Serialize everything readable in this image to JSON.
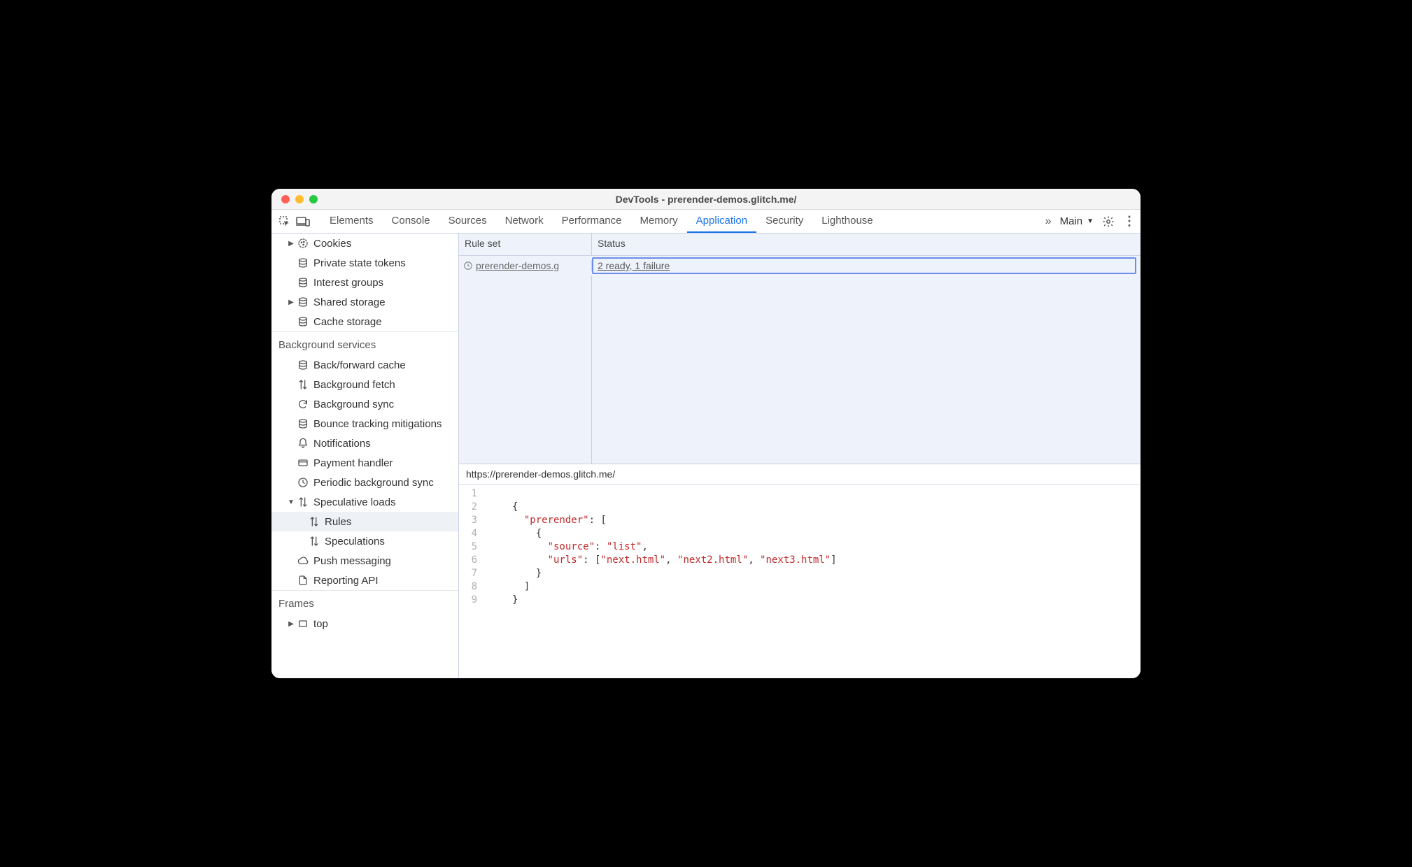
{
  "window_title": "DevTools - prerender-demos.glitch.me/",
  "toolbar": {
    "tabs": [
      "Elements",
      "Console",
      "Sources",
      "Network",
      "Performance",
      "Memory",
      "Application",
      "Security",
      "Lighthouse"
    ],
    "active_tab": "Application",
    "frame_label": "Main"
  },
  "sidebar": {
    "storage_items": [
      {
        "label": "Cookies",
        "icon": "cookie",
        "arrow": true
      },
      {
        "label": "Private state tokens",
        "icon": "db"
      },
      {
        "label": "Interest groups",
        "icon": "db"
      },
      {
        "label": "Shared storage",
        "icon": "db",
        "arrow": true
      },
      {
        "label": "Cache storage",
        "icon": "db"
      }
    ],
    "bg_header": "Background services",
    "bg_items": [
      {
        "label": "Back/forward cache",
        "icon": "db"
      },
      {
        "label": "Background fetch",
        "icon": "updown"
      },
      {
        "label": "Background sync",
        "icon": "sync"
      },
      {
        "label": "Bounce tracking mitigations",
        "icon": "db"
      },
      {
        "label": "Notifications",
        "icon": "bell"
      },
      {
        "label": "Payment handler",
        "icon": "card"
      },
      {
        "label": "Periodic background sync",
        "icon": "clock"
      },
      {
        "label": "Speculative loads",
        "icon": "updown",
        "arrow": true,
        "expanded": true,
        "children": [
          {
            "label": "Rules",
            "icon": "updown",
            "selected": true
          },
          {
            "label": "Speculations",
            "icon": "updown"
          }
        ]
      },
      {
        "label": "Push messaging",
        "icon": "cloud"
      },
      {
        "label": "Reporting API",
        "icon": "file"
      }
    ],
    "frames_header": "Frames",
    "frames_items": [
      {
        "label": "top",
        "icon": "rect",
        "arrow": true
      }
    ]
  },
  "grid": {
    "col_rule": "Rule set",
    "col_status": "Status",
    "row": {
      "icon": "clock",
      "rule_text": " prerender-demos.g",
      "status_text": "2 ready, 1 failure"
    }
  },
  "detail": {
    "url": "https://prerender-demos.glitch.me/",
    "code_lines": [
      "",
      "{",
      "  \"prerender\": [",
      "    {",
      "      \"source\": \"list\",",
      "      \"urls\": [\"next.html\", \"next2.html\", \"next3.html\"]",
      "    }",
      "  ]",
      "}"
    ]
  }
}
